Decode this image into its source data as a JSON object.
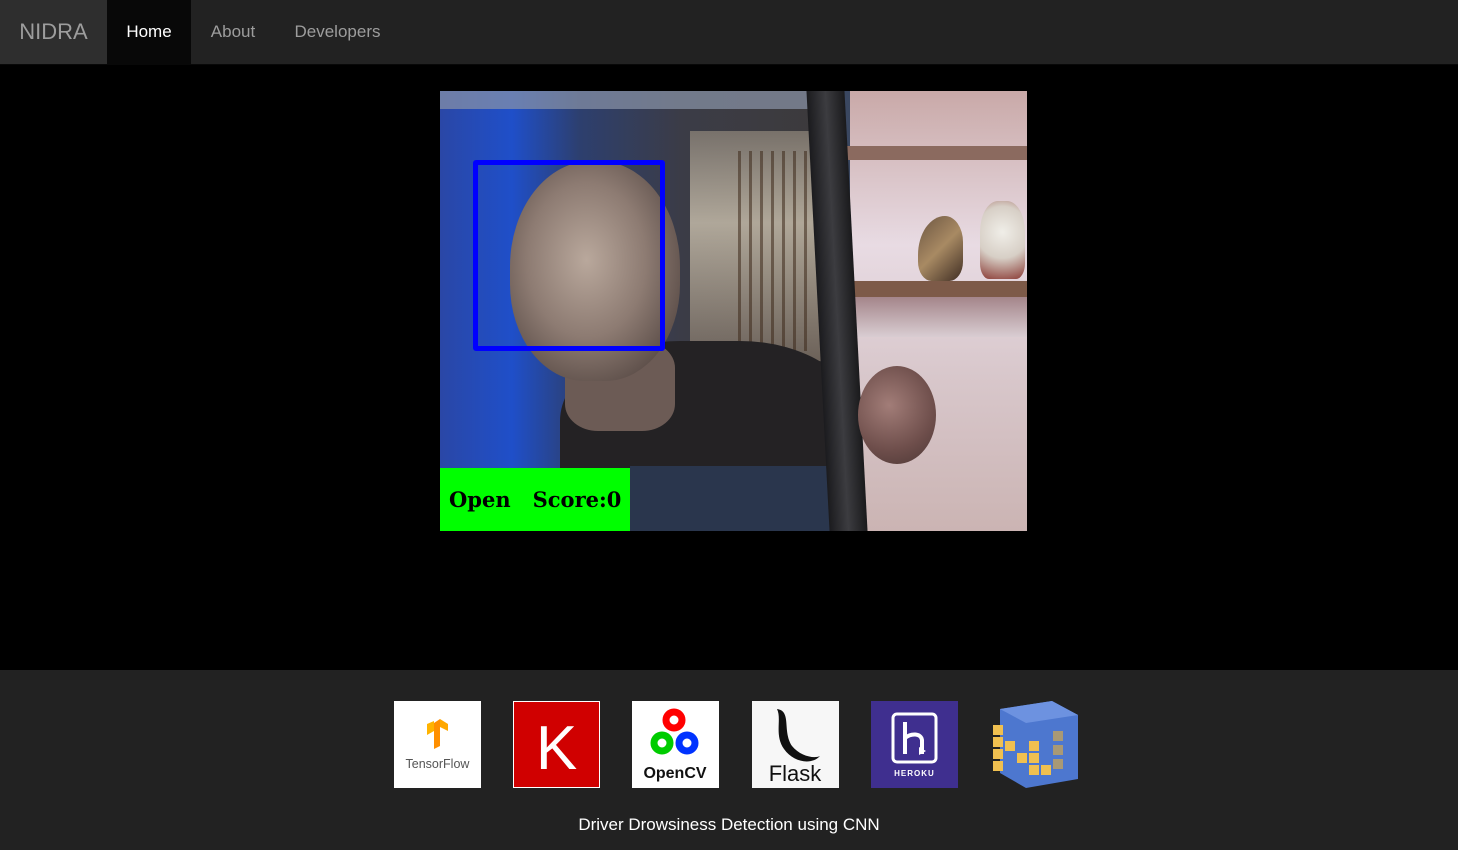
{
  "navbar": {
    "brand": "NIDRA",
    "items": [
      {
        "label": "Home",
        "active": true
      },
      {
        "label": "About",
        "active": false
      },
      {
        "label": "Developers",
        "active": false
      }
    ]
  },
  "video_feed": {
    "face_box_color": "#0000ff",
    "status": {
      "state": "Open",
      "score_text": "Score:0",
      "background": "#00ff00"
    }
  },
  "footer": {
    "logos": [
      {
        "icon": "tensorflow-logo-icon",
        "text": "TensorFlow"
      },
      {
        "icon": "keras-logo-icon",
        "text": "K"
      },
      {
        "icon": "opencv-logo-icon",
        "text": "OpenCV"
      },
      {
        "icon": "flask-logo-icon",
        "text": "Flask"
      },
      {
        "icon": "heroku-logo-icon",
        "text": "HEROKU"
      },
      {
        "icon": "numpy-logo-icon",
        "text": ""
      }
    ],
    "caption": "Driver Drowsiness Detection using CNN"
  }
}
